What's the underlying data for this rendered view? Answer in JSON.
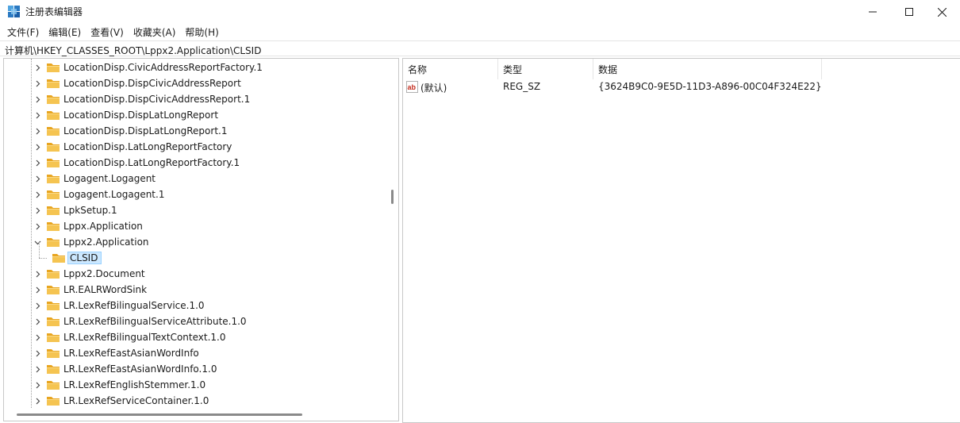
{
  "window": {
    "title": "注册表编辑器",
    "icon": "regedit-icon"
  },
  "menu": {
    "items": [
      "文件(F)",
      "编辑(E)",
      "查看(V)",
      "收藏夹(A)",
      "帮助(H)"
    ]
  },
  "address": {
    "path": "计算机\\HKEY_CLASSES_ROOT\\Lppx2.Application\\CLSID"
  },
  "tree": {
    "items": [
      {
        "label": "LocationDisp.CivicAddressReportFactory.1",
        "expanded": false
      },
      {
        "label": "LocationDisp.DispCivicAddressReport",
        "expanded": false
      },
      {
        "label": "LocationDisp.DispCivicAddressReport.1",
        "expanded": false
      },
      {
        "label": "LocationDisp.DispLatLongReport",
        "expanded": false
      },
      {
        "label": "LocationDisp.DispLatLongReport.1",
        "expanded": false
      },
      {
        "label": "LocationDisp.LatLongReportFactory",
        "expanded": false
      },
      {
        "label": "LocationDisp.LatLongReportFactory.1",
        "expanded": false
      },
      {
        "label": "Logagent.Logagent",
        "expanded": false
      },
      {
        "label": "Logagent.Logagent.1",
        "expanded": false
      },
      {
        "label": "LpkSetup.1",
        "expanded": false
      },
      {
        "label": "Lppx.Application",
        "expanded": false
      },
      {
        "label": "Lppx2.Application",
        "expanded": true
      },
      {
        "label": "CLSID",
        "child": true,
        "selected": true
      },
      {
        "label": "Lppx2.Document",
        "expanded": false
      },
      {
        "label": "LR.EALRWordSink",
        "expanded": false
      },
      {
        "label": "LR.LexRefBilingualService.1.0",
        "expanded": false
      },
      {
        "label": "LR.LexRefBilingualServiceAttribute.1.0",
        "expanded": false
      },
      {
        "label": "LR.LexRefBilingualTextContext.1.0",
        "expanded": false
      },
      {
        "label": "LR.LexRefEastAsianWordInfo",
        "expanded": false
      },
      {
        "label": "LR.LexRefEastAsianWordInfo.1.0",
        "expanded": false
      },
      {
        "label": "LR.LexRefEnglishStemmer.1.0",
        "expanded": false
      },
      {
        "label": "LR.LexRefServiceContainer.1.0",
        "expanded": false
      }
    ]
  },
  "values": {
    "headers": {
      "name": "名称",
      "type": "类型",
      "data": "数据"
    },
    "rows": [
      {
        "icon": "string-value-icon",
        "name": "(默认)",
        "type": "REG_SZ",
        "data": "{3624B9C0-9E5D-11D3-A896-00C04F324E22}"
      }
    ]
  },
  "colors": {
    "selection": "#cce8ff",
    "selection_border": "#99d1ff",
    "folder": "#f5c451",
    "accent": "#0067c0"
  }
}
